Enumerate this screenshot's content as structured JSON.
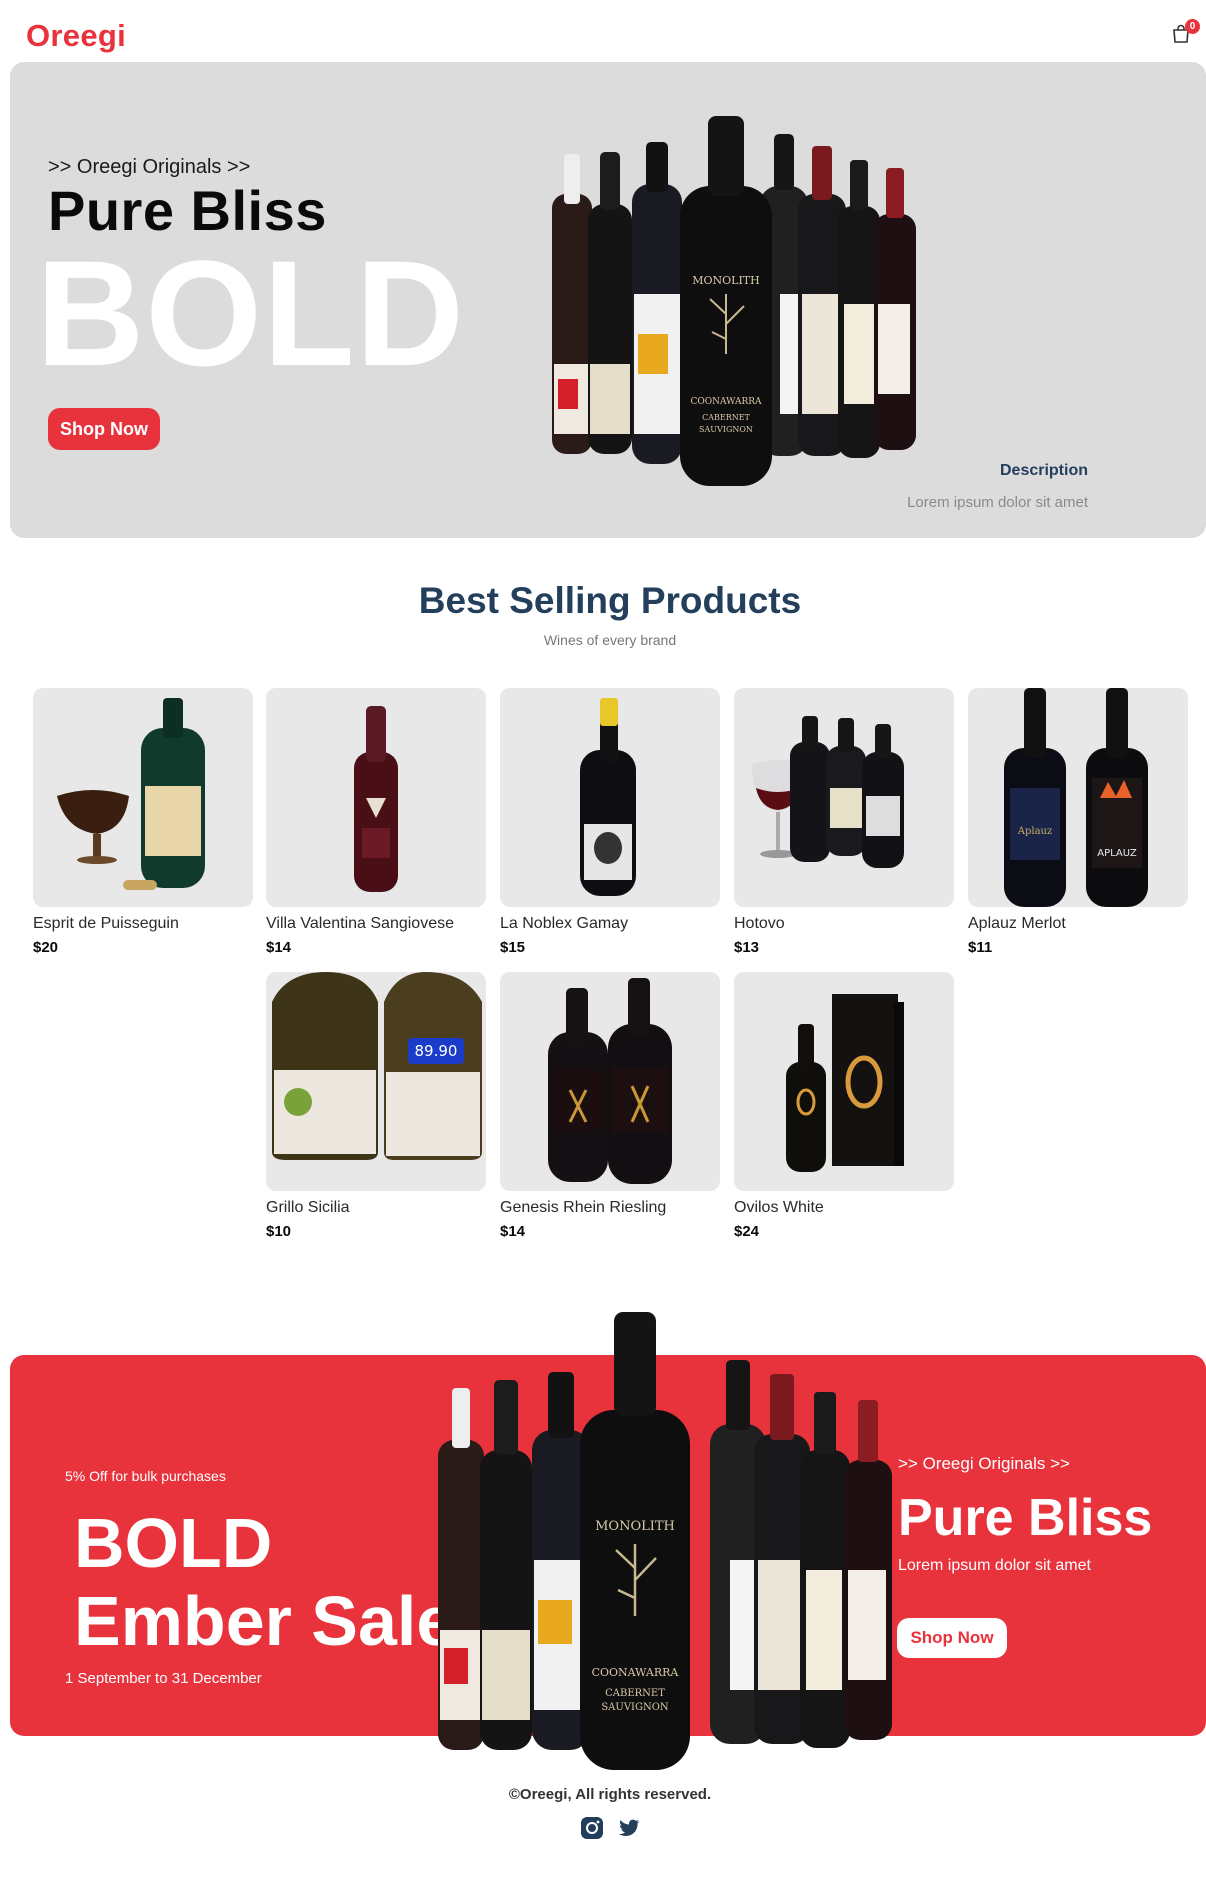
{
  "brand": {
    "logo": "Oreegi",
    "accent_color": "#e8323c",
    "heading_color": "#243f5c"
  },
  "header": {
    "cart_icon": "shopping-bag-icon",
    "cart_count": "0"
  },
  "hero": {
    "eyebrow": ">> Oreegi Originals >>",
    "title": "Pure Bliss",
    "big_word": "BOLD",
    "button": "Shop Now",
    "description_title": "Description",
    "description_text": "Lorem ipsum dolor sit amet",
    "background": "#dcdcdc"
  },
  "best_selling": {
    "title": "Best Selling Products",
    "subtitle": "Wines of every brand",
    "products": [
      {
        "name": "Esprit de Puisseguin",
        "price": "$20"
      },
      {
        "name": "Villa Valentina Sangiovese",
        "price": "$14"
      },
      {
        "name": "La Noblex Gamay",
        "price": "$15"
      },
      {
        "name": "Hotovo",
        "price": "$13"
      },
      {
        "name": "Aplauz Merlot",
        "price": "$11"
      },
      {
        "name": "Grillo Sicilia",
        "price": "$10"
      },
      {
        "name": "Genesis Rhein Riesling",
        "price": "$14"
      },
      {
        "name": "Ovilos White",
        "price": "$24"
      }
    ]
  },
  "promo": {
    "offer": "5% Off for bulk purchases",
    "line1": "BOLD",
    "line2": "Ember Sale",
    "dates": "1 September to 31 December",
    "eyebrow": ">> Oreegi Originals >>",
    "title": "Pure Bliss",
    "text": "Lorem ipsum dolor sit amet",
    "button": "Shop Now"
  },
  "footer": {
    "copyright": "©Oreegi, All rights reserved.",
    "social_icons": [
      "instagram-icon",
      "twitter-icon"
    ]
  }
}
